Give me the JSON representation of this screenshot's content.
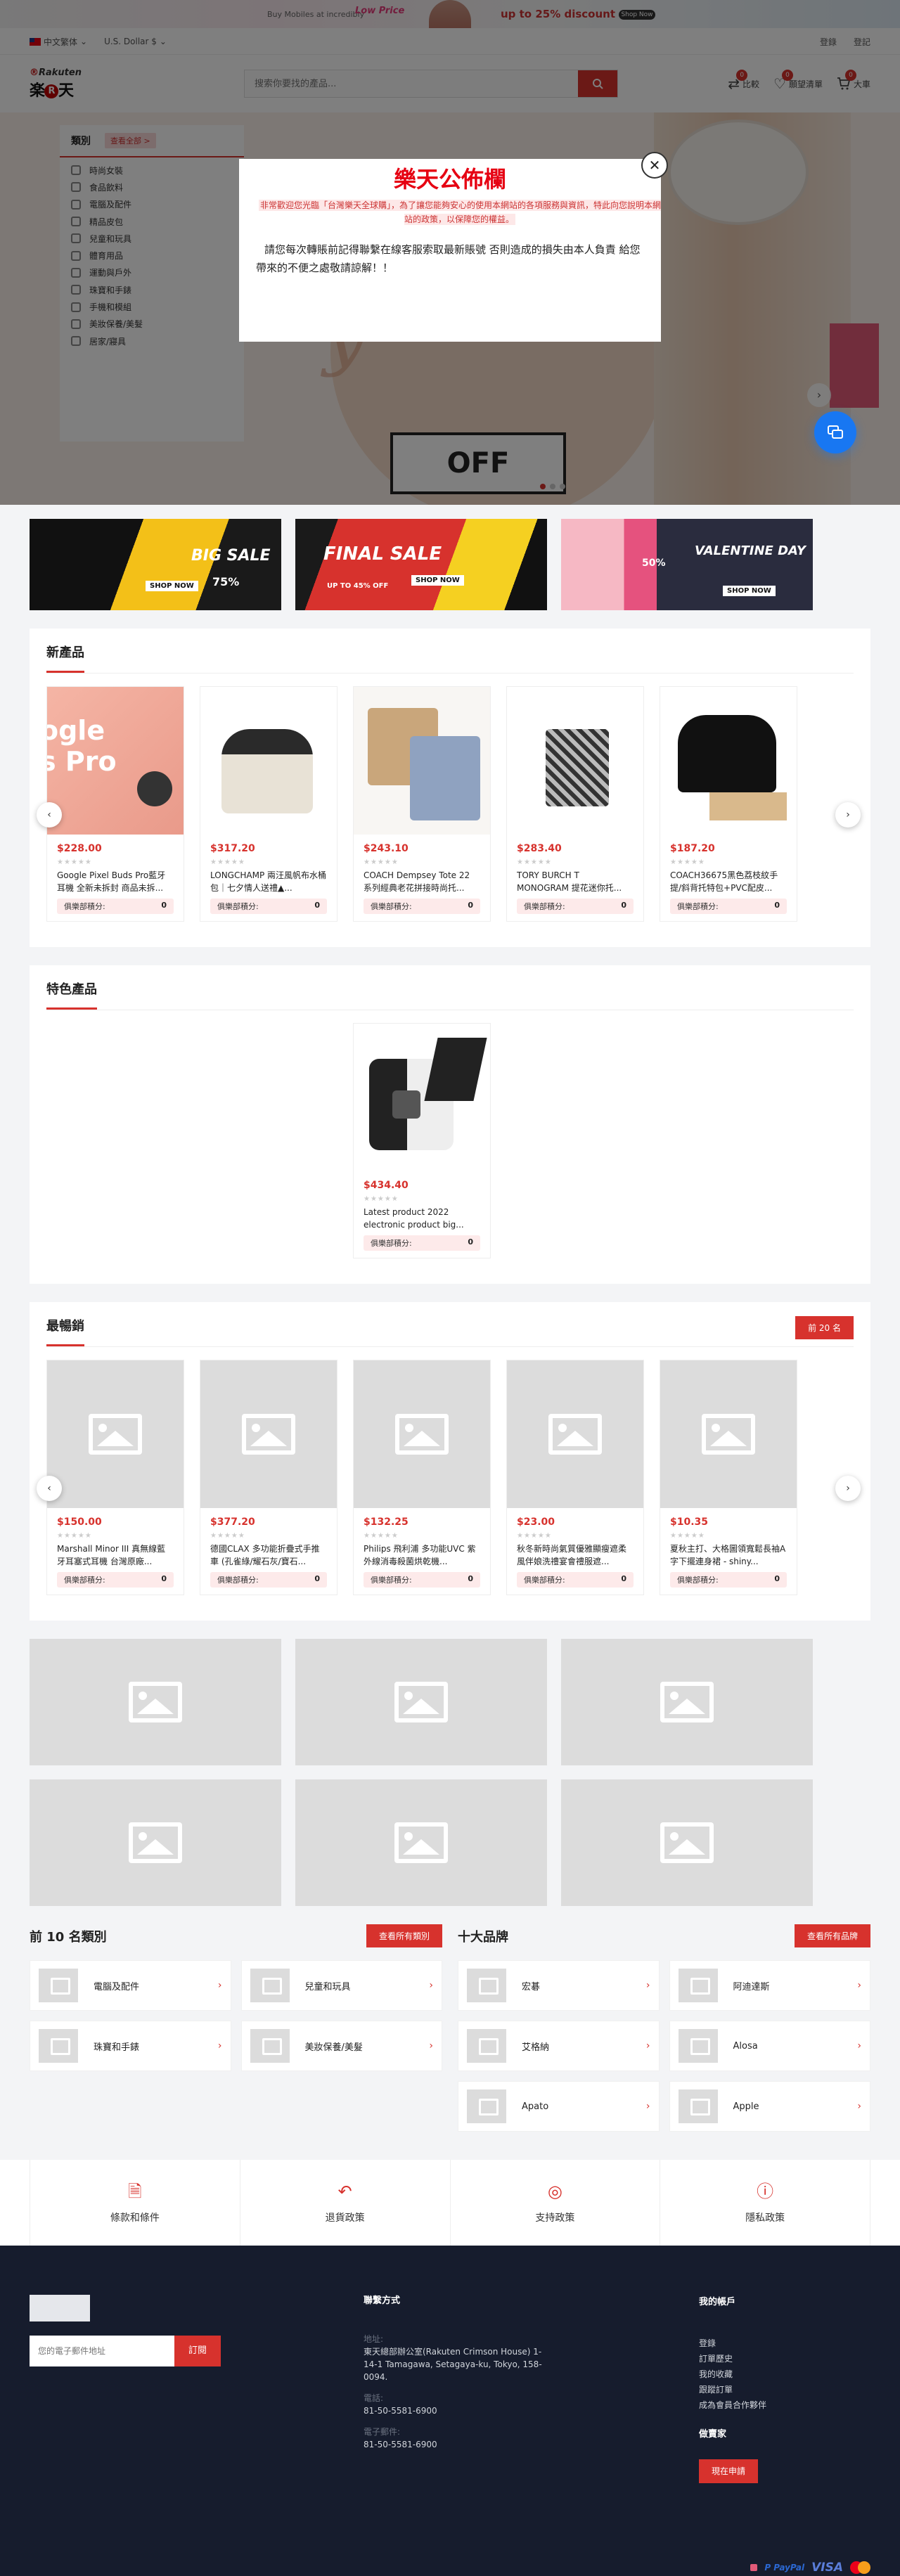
{
  "promo": {
    "text1": "Buy Mobiles at incredibly",
    "text2": "Low Price",
    "text3": "up to 25% discount",
    "button": "Shop Now"
  },
  "topbar": {
    "language": "中文繁体",
    "currency": "U.S. Dollar $",
    "login": "登錄",
    "register": "登記"
  },
  "header": {
    "logo_top": "Rakuten",
    "logo_main": "楽",
    "logo_mid": "天",
    "search_placeholder": "搜索你要找的產品...",
    "compare_label": "比較",
    "compare_count": "0",
    "wishlist_label": "願望清單",
    "wishlist_count": "0",
    "cart_label": "大車",
    "cart_count": "0"
  },
  "categories": {
    "title": "類別",
    "view_all": "查看全部 >",
    "items": [
      "時尚女裝",
      "食品飲料",
      "電腦及配件",
      "精品皮包",
      "兒童和玩具",
      "體育用品",
      "運動與戶外",
      "珠寶和手錶",
      "手機和模組",
      "美妝保養/美髮",
      "居家/寢具"
    ]
  },
  "hero": {
    "off_text": "OFF"
  },
  "modal": {
    "title": "樂天公佈欄",
    "notice": "非常歡迎您光臨「台灣樂天全球購」，為了讓您能夠安心的使用本網站的各項服務與資訊，特此向您說明本網站的政策，以保障您的權益。",
    "message": "請您每次轉賬前記得聯繫在線客服索取最新賬號  否則造成的損失由本人負責 給您帶來的不便之處敬請諒解！！",
    "close": "✕"
  },
  "banners": [
    {
      "big": "BIG SALE",
      "small": "75%",
      "tag": "SHOP NOW"
    },
    {
      "big": "FINAL SALE",
      "small": "UP TO 45% OFF",
      "tag": "SHOP NOW"
    },
    {
      "big": "VALENTINE DAY",
      "small": "50%",
      "tag": "SHOP NOW"
    }
  ],
  "new_products": {
    "title": "新產品",
    "club_label": "俱樂部積分:",
    "items": [
      {
        "price": "$228.00",
        "name": "Google Pixel Buds Pro藍牙耳機 全新未拆封 商品未拆...",
        "points": "0"
      },
      {
        "price": "$317.20",
        "name": "LONGCHAMP 兩汪風帆布水桶包｜七夕情人送禮▲...",
        "points": "0"
      },
      {
        "price": "$243.10",
        "name": "COACH Dempsey Tote 22 系列經典老花拼接時尚托...",
        "points": "0"
      },
      {
        "price": "$283.40",
        "name": "TORY BURCH T MONOGRAM 提花迷你托...",
        "points": "0"
      },
      {
        "price": "$187.20",
        "name": "COACH36675黑色荔枝紋手提/斜背托特包+PVC配皮...",
        "points": "0"
      }
    ]
  },
  "featured": {
    "title": "特色產品",
    "items": [
      {
        "price": "$434.40",
        "name": "Latest product 2022 electronic product big...",
        "points": "0"
      }
    ]
  },
  "bestsellers": {
    "title": "最暢銷",
    "more": "前 20 名",
    "items": [
      {
        "price": "$150.00",
        "name": "Marshall Minor III 真無線藍牙耳塞式耳機 台灣原廠...",
        "points": "0"
      },
      {
        "price": "$377.20",
        "name": "德國CLAX 多功能折疊式手推車 (孔雀綠/耀石灰/寶石...",
        "points": "0"
      },
      {
        "price": "$132.25",
        "name": "Philips 飛利浦 多功能UVC 紫外線消毒殺菌烘乾機...",
        "points": "0"
      },
      {
        "price": "$23.00",
        "name": "秋冬新時尚氣質優雅顯瘦遮柔風伴娘洗禮宴會禮服遮...",
        "points": "0"
      },
      {
        "price": "$10.35",
        "name": "夏秋主打、大格圖領寬鬆長袖A字下擺連身裙 - shiny...",
        "points": "0"
      }
    ]
  },
  "top_categories": {
    "title": "前 10 名類別",
    "more": "查看所有類別",
    "items": [
      "電腦及配件",
      "兒童和玩具",
      "珠寶和手錶",
      "美妝保養/美髮"
    ]
  },
  "top_brands": {
    "title": "十大品牌",
    "more": "查看所有品牌",
    "items": [
      "宏碁",
      "阿迪達斯",
      "艾格納",
      "Alosa",
      "Apato",
      "Apple"
    ]
  },
  "policies": [
    "條款和條件",
    "退貨政策",
    "支持政策",
    "隱私政策"
  ],
  "footer": {
    "email_placeholder": "您的電子郵件地址",
    "subscribe": "訂閱",
    "contact_title": "聯繫方式",
    "address_label": "地址:",
    "address": "東天總部辦公室(Rakuten Crimson House) 1-14-1 Tamagawa, Setagaya-ku, Tokyo, 158-0094.",
    "phone_label": "電話:",
    "phone": "81-50-5581-6900",
    "email_label": "電子郵件:",
    "email": "81-50-5581-6900",
    "account_title": "我的帳戶",
    "account_links": [
      "登錄",
      "訂單歷史",
      "我的收藏",
      "跟蹤訂單",
      "成為會員合作夥伴"
    ],
    "seller_title": "做賣家",
    "apply": "現在申請",
    "payments": [
      "P PayPal",
      "VISA"
    ]
  },
  "colors": {
    "accent": "#d7322d",
    "footer_bg": "#161c2d",
    "chat": "#1877f2"
  }
}
